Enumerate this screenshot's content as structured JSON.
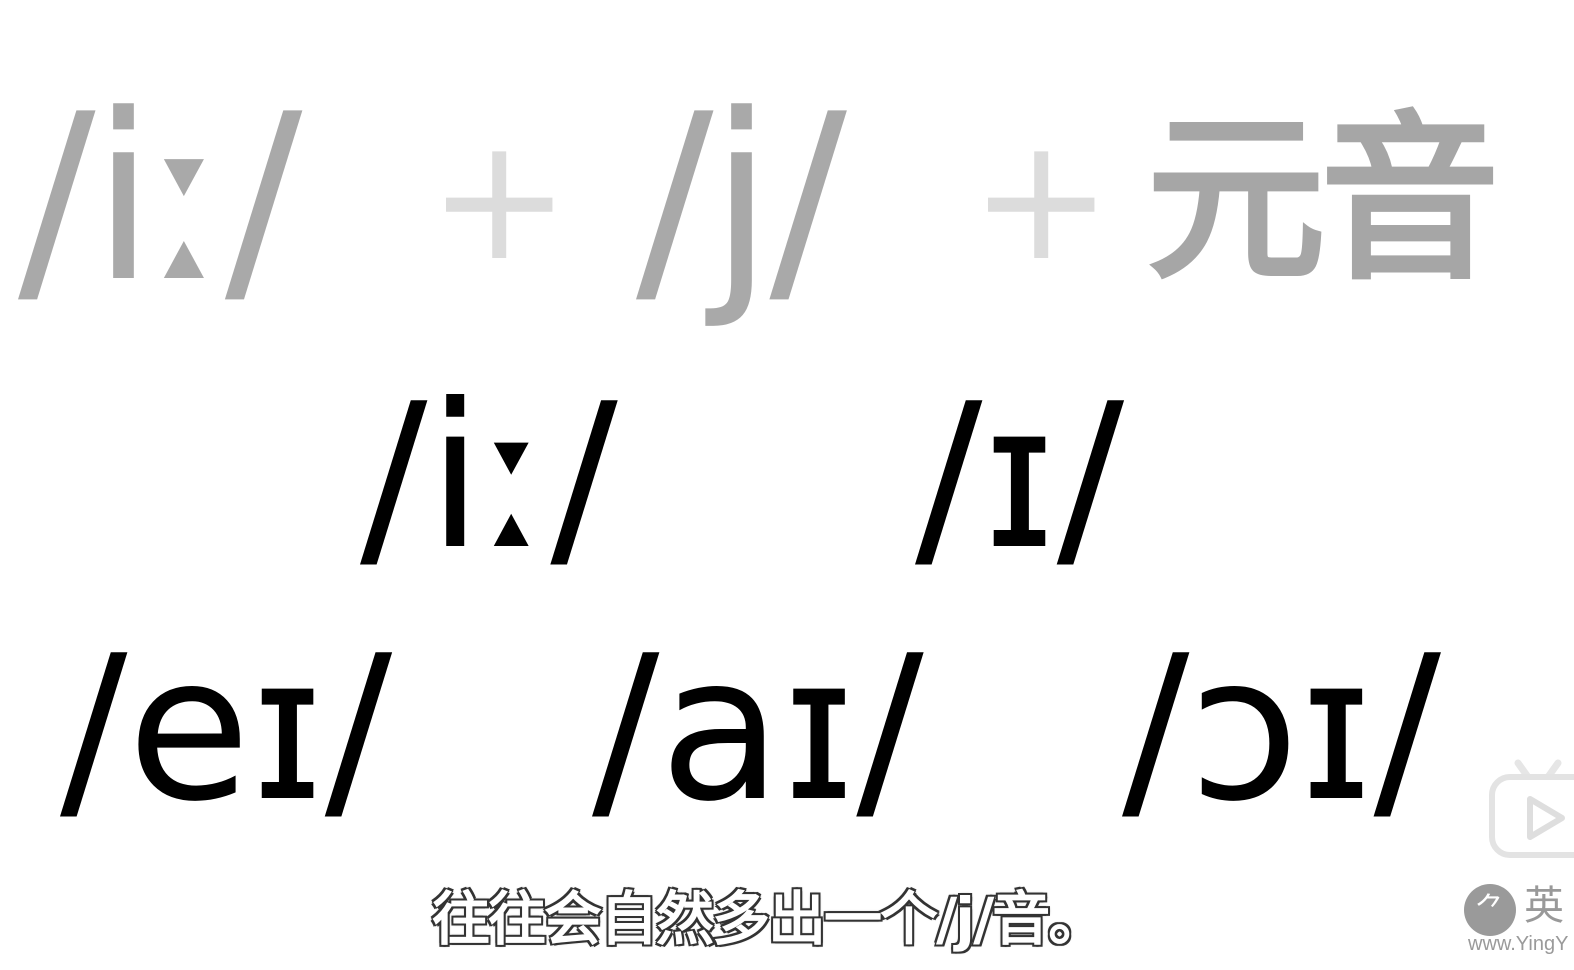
{
  "formula": {
    "part1": "/iː/",
    "plus1": "+",
    "part2": "/j/",
    "plus2": "+",
    "part3": "元音"
  },
  "row1": [
    "/iː/",
    "/ɪ/"
  ],
  "row2": [
    "/eɪ/",
    "/aɪ/",
    "/ɔɪ/"
  ],
  "subtitle": "往往会自然多出一个/j/音。",
  "watermark": {
    "logo_glyph": "⺈",
    "char": "英",
    "url": "www.YingY"
  },
  "icons": {
    "player": "bilibili-tv-play-icon"
  },
  "colors": {
    "background": "#ffffff",
    "formula_gray": "#a9a9a9",
    "plus_gray": "#dcdcdc",
    "phonetic": "#000000"
  }
}
